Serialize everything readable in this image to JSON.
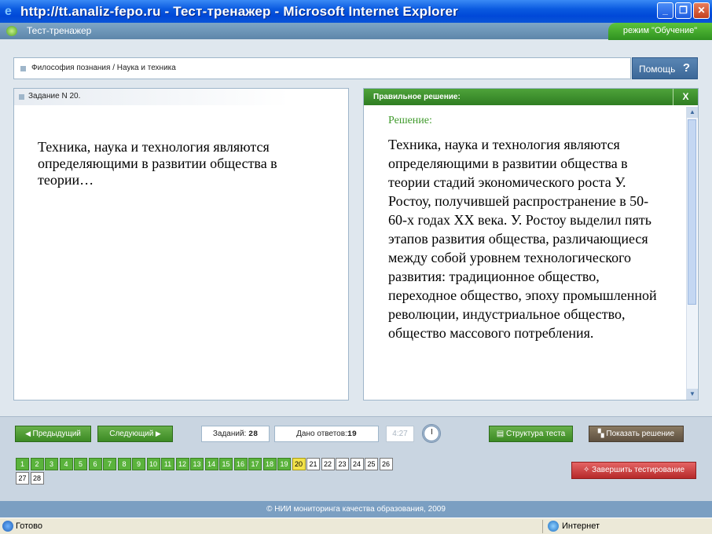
{
  "window": {
    "title": "http://tt.analiz-fepo.ru - Тест-тренажер - Microsoft Internet Explorer",
    "minimize": "_",
    "maximize": "❐",
    "close": "✕"
  },
  "app": {
    "title": "Тест-тренажер",
    "mode": "режим \"Обучение\""
  },
  "breadcrumb": "Философия познания / Наука и техника",
  "help": {
    "label": "Помощь",
    "icon": "?"
  },
  "task": {
    "label": "Задание N 20.",
    "question": "Техника, наука и технология являются определяющими в развитии общества в теории…"
  },
  "solution": {
    "header": "Правильное решение:",
    "close": "X",
    "caption": "Решение:",
    "text": "Техника, наука и технология являются определяющими в развитии общества в теории стадий экономического роста У. Ростоу, получившей распространение в 50-60-х годах XX века. У. Ростоу выделил пять этапов развития общества, различающиеся между собой уровнем технологического развития: традиционное общество, переходное общество, эпоху промышленной революции, индустриальное общество, общество массового потребления."
  },
  "nav": {
    "prev": "Предыдущий",
    "next": "Следующий",
    "tasks_label": "Заданий:",
    "tasks_count": "28",
    "answers_label": "Дано ответов:",
    "answers_count": "19",
    "timer": "4:27",
    "structure": "Структура теста",
    "show_solution": "Показать решение",
    "finish": "Завершить тестирование"
  },
  "questions": {
    "done": [
      "1",
      "2",
      "3",
      "4",
      "5",
      "6",
      "7",
      "8",
      "9",
      "10",
      "11",
      "12",
      "13",
      "14",
      "15",
      "16",
      "17",
      "18",
      "19"
    ],
    "current": "20",
    "todo": [
      "21",
      "22",
      "23",
      "24",
      "25",
      "26",
      "27",
      "28"
    ]
  },
  "footer": "© НИИ мониторинга качества образования, 2009",
  "status": {
    "left": "Готово",
    "zone": "Интернет"
  },
  "colors": {
    "accent_green": "#3f9a2b",
    "title_blue": "#0a55d8",
    "current_question": "#f3e34a"
  }
}
